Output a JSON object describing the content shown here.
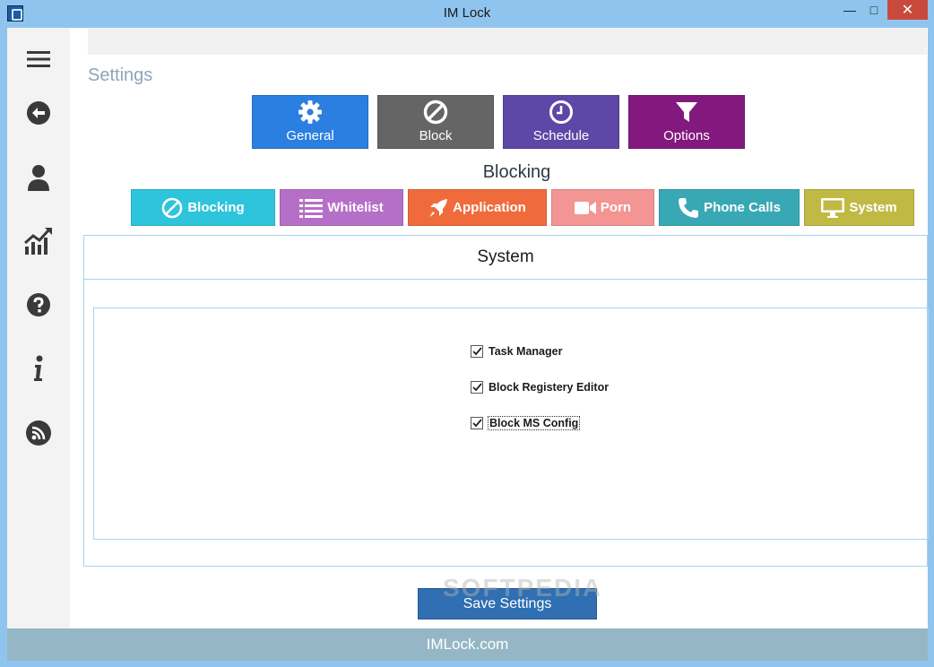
{
  "window": {
    "title": "IM Lock",
    "minimize": "—",
    "maximize": "□",
    "close": "✕"
  },
  "page": {
    "title": "Settings"
  },
  "categories": [
    {
      "label": "General",
      "icon": "gear-icon",
      "color": "#2b7fe0"
    },
    {
      "label": "Block",
      "icon": "block-icon",
      "color": "#656565"
    },
    {
      "label": "Schedule",
      "icon": "clock-icon",
      "color": "#5e47a6"
    },
    {
      "label": "Options",
      "icon": "filter-icon",
      "color": "#83197e"
    }
  ],
  "section": {
    "heading": "Blocking"
  },
  "sub_tabs": [
    {
      "label": "Blocking",
      "icon": "block-icon",
      "color": "#2ec4dc"
    },
    {
      "label": "Whitelist",
      "icon": "list-icon",
      "color": "#b66fc7"
    },
    {
      "label": "Application",
      "icon": "rocket-icon",
      "color": "#ef6b3c"
    },
    {
      "label": "Porn",
      "icon": "video-camera-icon",
      "color": "#f39593"
    },
    {
      "label": "Phone Calls",
      "icon": "phone-icon",
      "color": "#38a8b4"
    },
    {
      "label": "System",
      "icon": "monitor-icon",
      "color": "#c0ba44"
    }
  ],
  "panel": {
    "title": "System",
    "options": [
      {
        "label": "Task Manager",
        "checked": true
      },
      {
        "label": "Block Registery Editor",
        "checked": true
      },
      {
        "label": "Block MS Config",
        "checked": true
      }
    ]
  },
  "save_button": {
    "label": "Save Settings"
  },
  "watermark": "SOFTPEDIA",
  "footer": {
    "text": "IMLock.com"
  },
  "sidebar_icons": [
    "menu-icon",
    "back-arrow-icon",
    "user-icon",
    "chart-icon",
    "help-icon",
    "info-icon",
    "rss-icon"
  ]
}
